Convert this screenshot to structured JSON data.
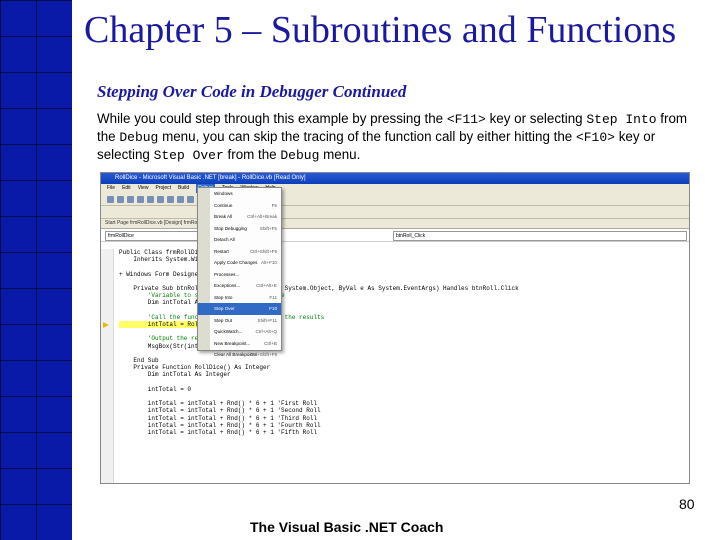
{
  "slide": {
    "title": "Chapter 5 – Subroutines and Functions",
    "subtitle": "Stepping Over Code in Debugger Continued",
    "paragraph": {
      "t1": "While you could step through this example by pressing the ",
      "c1": "<F11>",
      "t2": " key or selecting ",
      "c2": "Step Into",
      "t3": " from the ",
      "c3": "Debug",
      "t4": " menu, you can skip the tracing of the function call by either hitting the ",
      "c4": "<F10>",
      "t5": " key or selecting ",
      "c5": "Step Over",
      "t6": " from the ",
      "c6": "Debug",
      "t7": " menu."
    },
    "page_number": "80",
    "footer": "The Visual Basic .NET Coach"
  },
  "screenshot": {
    "window_title": "RollDice - Microsoft Visual Basic .NET [break] - RollDice.vb [Read Only]",
    "menu": [
      "File",
      "Edit",
      "View",
      "Project",
      "Build",
      "Debug",
      "Tools",
      "Window",
      "Help"
    ],
    "active_menu": "Debug",
    "tabs": "Start Page   frmRollDice.vb [Design]   frmRollDice.vb",
    "object_combo": "frmRollDice",
    "event_combo": "btnRoll_Click",
    "debug_menu": [
      {
        "label": "Windows",
        "key": ""
      },
      {
        "label": "Continue",
        "key": "F5"
      },
      {
        "label": "Break All",
        "key": "Ctrl+Alt+Break"
      },
      {
        "label": "Stop Debugging",
        "key": "Shift+F5"
      },
      {
        "label": "Detach All",
        "key": ""
      },
      {
        "label": "Restart",
        "key": "Ctrl+Shift+F5"
      },
      {
        "label": "Apply Code Changes",
        "key": "Alt+F10"
      },
      {
        "label": "Processes...",
        "key": ""
      },
      {
        "label": "Exceptions...",
        "key": "Ctrl+Alt+E"
      },
      {
        "label": "Step Into",
        "key": "F11"
      },
      {
        "label": "Step Over",
        "key": "F10"
      },
      {
        "label": "Step Out",
        "key": "Shift+F11"
      },
      {
        "label": "QuickWatch...",
        "key": "Ctrl+Alt+Q"
      },
      {
        "label": "New Breakpoint...",
        "key": "Ctrl+B"
      },
      {
        "label": "Clear All Breakpoints",
        "key": "Ctrl+Shift+F9"
      }
    ],
    "selected_menu_item": "Step Over",
    "code_lines": [
      "Public Class frmRollDice",
      "    Inherits System.Windows.Forms.Form",
      "",
      "+ Windows Form Designer generated code",
      "",
      "    Private Sub btnRoll_Click(ByVal sender As System.Object, ByVal e As System.EventArgs) Handles btnRoll.Click",
      "        'Variable to store the sum of the dice",
      "        Dim intTotal As Integer",
      "",
      "        'Call the function RollDice and store the results",
      "        intTotal = RollDice()",
      "",
      "        'Output the result",
      "        MsgBox(Str(intTotal))",
      "",
      "    End Sub",
      "    Private Function RollDice() As Integer",
      "        Dim intTotal As Integer",
      "",
      "        intTotal = 0",
      "",
      "        intTotal = intTotal + Rnd() * 6 + 1 'First Roll",
      "        intTotal = intTotal + Rnd() * 6 + 1 'Second Roll",
      "        intTotal = intTotal + Rnd() * 6 + 1 'Third Roll",
      "        intTotal = intTotal + Rnd() * 6 + 1 'Fourth Roll",
      "        intTotal = intTotal + Rnd() * 6 + 1 'Fifth Roll"
    ],
    "current_line_index": 10
  }
}
